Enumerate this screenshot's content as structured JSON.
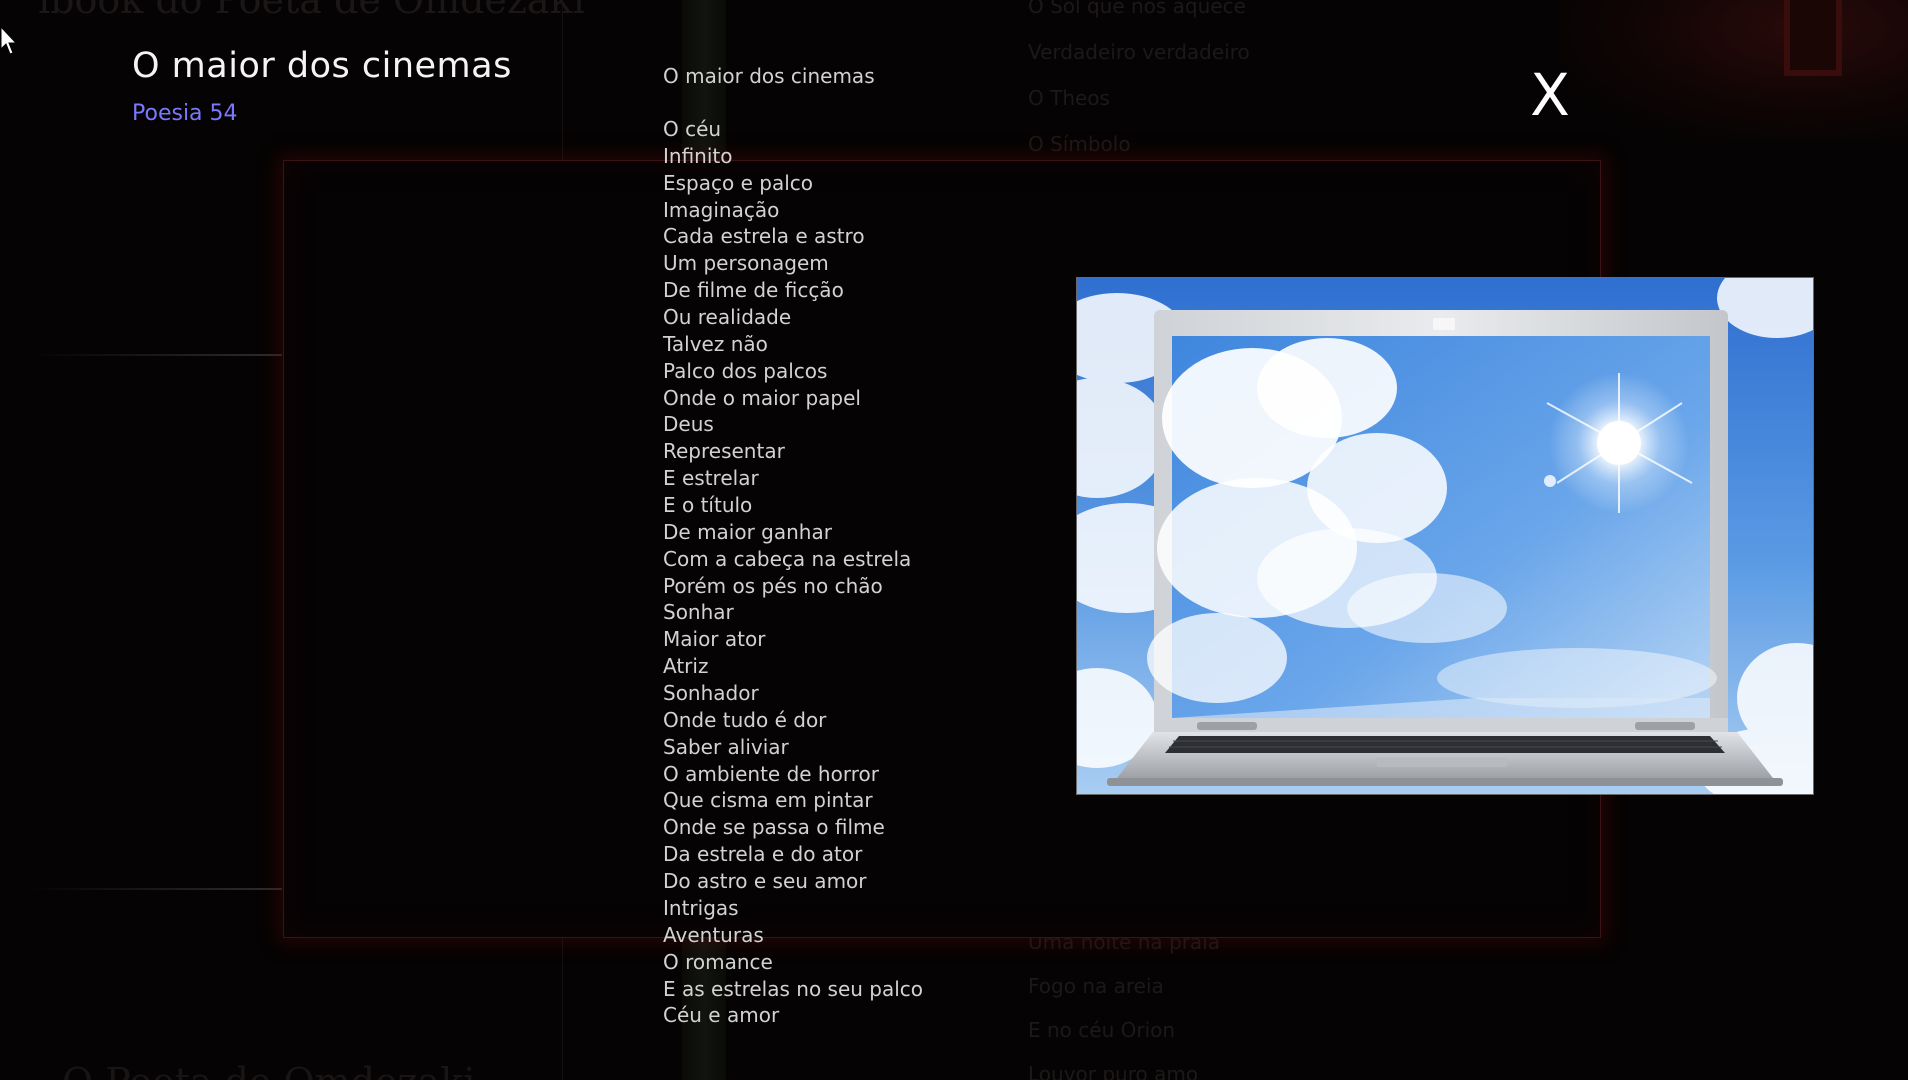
{
  "background": {
    "book_title": "ibook do Poeta de Omdezaki",
    "bottom_title": "O Poeta de Omdezaki",
    "poem_list_top": [
      "O Sol que nos aquece",
      "Verdadeiro verdadeiro",
      "O Theos",
      "O Símbolo"
    ],
    "poem_list_bottom": [
      "Uma noite na praia",
      "Fogo na areia",
      "E no céu Orion",
      "Louvor puro amo"
    ]
  },
  "popup": {
    "title": "O maior dos cinemas",
    "subtitle": "Poesia 54",
    "close_label": "X",
    "poem": {
      "heading": "O maior dos cinemas",
      "lines": [
        "O céu",
        "Infinito",
        "Espaço e palco",
        "Imaginação",
        "Cada estrela e astro",
        "Um personagem",
        "De filme de ficção",
        "Ou realidade",
        "Talvez não",
        "Palco dos palcos",
        "Onde o maior papel",
        "Deus",
        "Representar",
        "E estrelar",
        "E o título",
        "De maior ganhar",
        "Com a cabeça na estrela",
        "Porém os pés no chão",
        "Sonhar",
        "Maior ator",
        "Atriz",
        "Sonhador",
        "Onde tudo é dor",
        "Saber aliviar",
        "O ambiente de horror",
        "Que cisma em pintar",
        "Onde se passa o filme",
        "Da estrela e do ator",
        "Do astro e seu amor",
        "Intrigas",
        "Aventuras",
        "O romance",
        "E as estrelas no seu palco",
        "Céu e amor"
      ]
    }
  },
  "colors": {
    "title_text": "#f4f4f4",
    "subtitle_accent": "#7a78ff",
    "poem_text": "#d2d2d2",
    "frame_glow": "#5a0a0a"
  },
  "icons": {
    "close": "x-letter",
    "cursor": "arrow-pointer-icon",
    "illustration": "laptop-sky-sun-image"
  }
}
